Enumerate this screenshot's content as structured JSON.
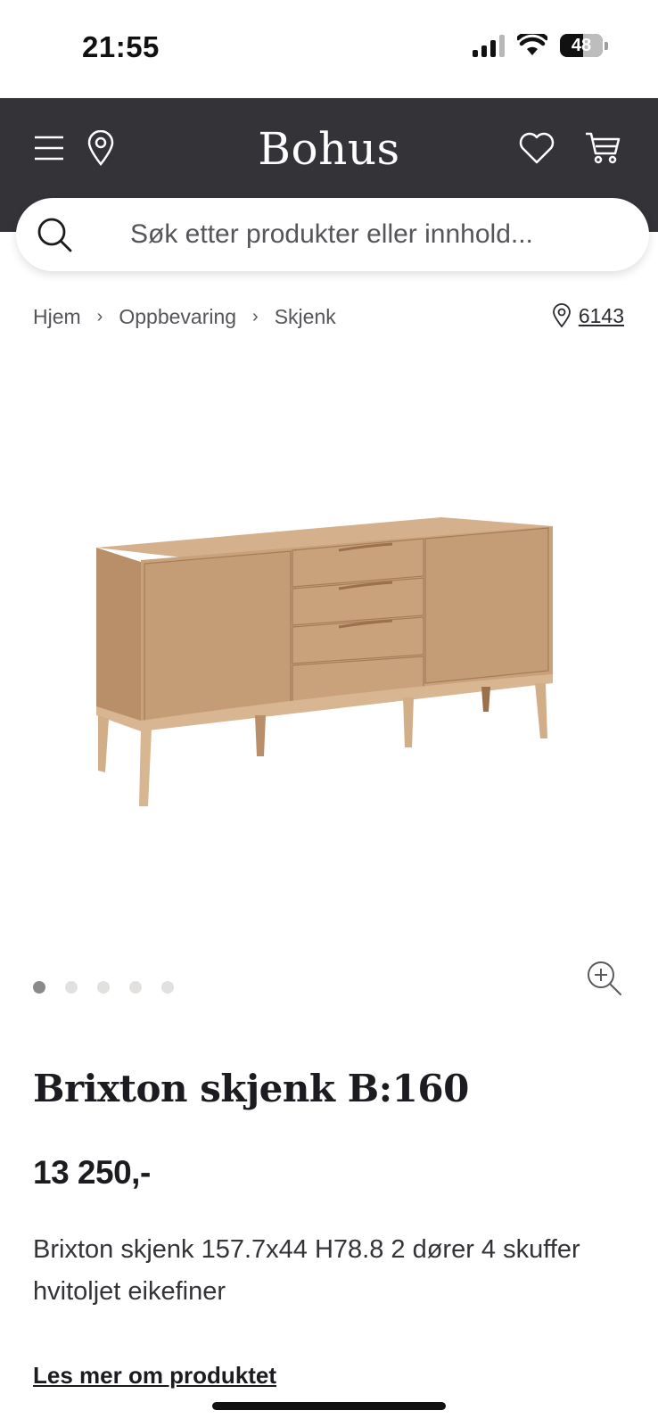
{
  "status_bar": {
    "time": "21:55",
    "battery": "48"
  },
  "header": {
    "brand": "Bohus",
    "icons": [
      "menu-icon",
      "location-pin-icon",
      "heart-icon",
      "cart-icon"
    ]
  },
  "search": {
    "placeholder": "Søk etter produkter eller innhold..."
  },
  "breadcrumb": {
    "items": [
      "Hjem",
      "Oppbevaring",
      "Skjenk"
    ],
    "separator": "›"
  },
  "store": {
    "label": "6143"
  },
  "gallery": {
    "image_count": 5,
    "active_index": 0
  },
  "product": {
    "title": "Brixton skjenk B:160",
    "price": "13 250,-",
    "description": "Brixton skjenk 157.7x44 H78.8 2 dører 4 skuffer hvitoljet eikefiner",
    "read_more": "Les mer om produktet"
  },
  "colors": {
    "header_bg": "#333338",
    "gallery_bg": "#f4f3f1",
    "wood": "#c9a27c"
  }
}
